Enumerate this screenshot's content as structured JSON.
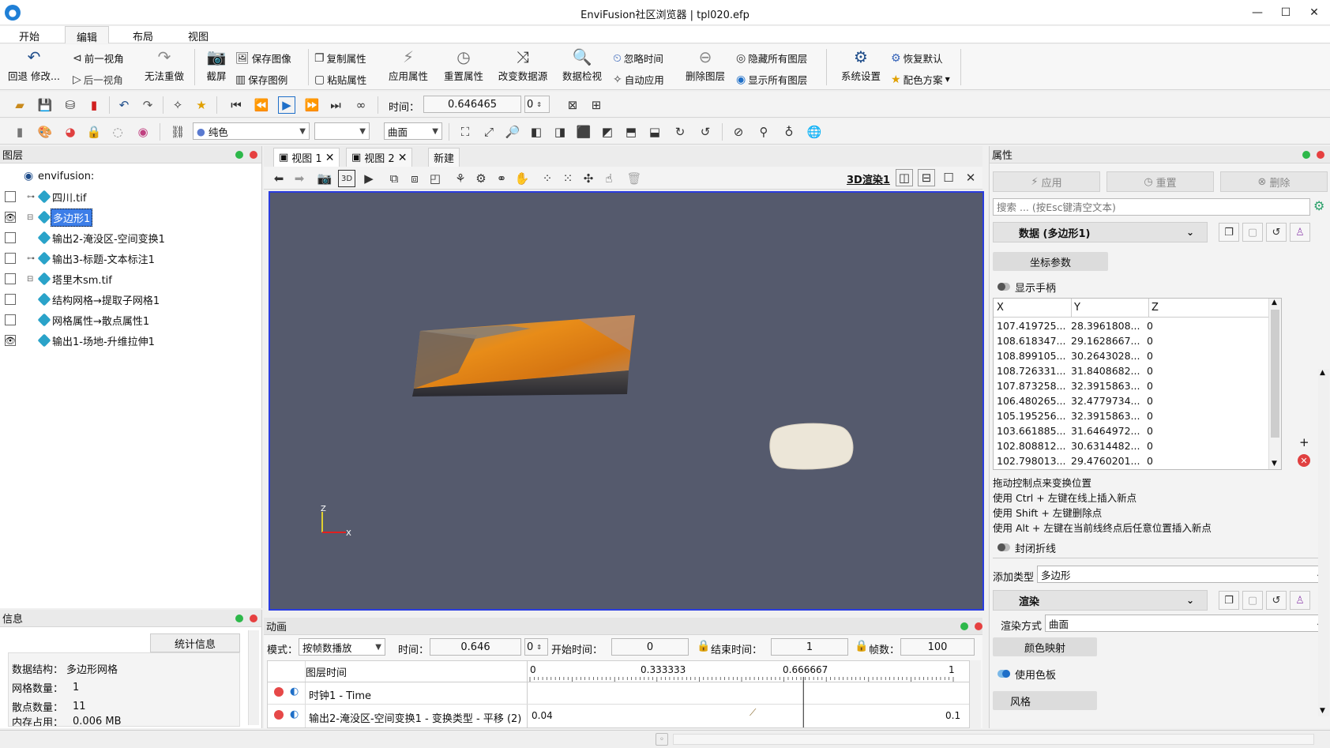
{
  "window": {
    "title": "EnviFusion社区浏览器 | tpl020.efp",
    "minimize": "—",
    "maximize": "☐",
    "close": "✕"
  },
  "menu": {
    "tabs": [
      "开始",
      "编辑",
      "布局",
      "视图"
    ],
    "active": "编辑"
  },
  "ribbon": {
    "undo": "回退 修改...",
    "prev_view": "前一视角",
    "next_view": "后一视角",
    "redo": "无法重做",
    "screenshot": "截屏",
    "save_image": "保存图像",
    "save_legend": "保存图例",
    "copy_props": "复制属性",
    "paste_props": "粘贴属性",
    "apply_props": "应用属性",
    "reset_props": "重置属性",
    "change_source": "改变数据源",
    "data_inspect": "数据检视",
    "ignore_time": "忽略时间",
    "auto_apply": "自动应用",
    "delete_layer": "删除图层",
    "hide_all": "隐藏所有图层",
    "show_all": "显示所有图层",
    "system_settings": "系统设置",
    "restore_default": "恢复默认",
    "color_scheme": "配色方案"
  },
  "toolbar2": {
    "time_label": "时间：",
    "time_value": "0.646465",
    "step_value": "0"
  },
  "toolbar3": {
    "color_mode": "纯色",
    "blank_combo": "",
    "surface_mode": "曲面"
  },
  "layers_panel": {
    "title": "图层",
    "root": "envifusion:",
    "items": [
      {
        "label": "四川.tif",
        "visible": false
      },
      {
        "label": "多边形1",
        "visible": true,
        "selected": true
      },
      {
        "label": "输出2-淹没区-空间变换1",
        "visible": false
      },
      {
        "label": "输出3-标题-文本标注1",
        "visible": false
      },
      {
        "label": "塔里木sm.tif",
        "visible": false
      },
      {
        "label": "结构网格→提取子网格1",
        "visible": false
      },
      {
        "label": "网格属性→散点属性1",
        "visible": false
      },
      {
        "label": "输出1-场地-升维拉伸1",
        "visible": true
      }
    ]
  },
  "info_panel": {
    "title": "信息",
    "tab": "统计信息",
    "rows": [
      {
        "label": "数据结构：",
        "value": "多边形网格"
      },
      {
        "label": "网格数量：",
        "value": "1"
      },
      {
        "label": "散点数量：",
        "value": "11"
      },
      {
        "label": "内存占用：",
        "value": "0.006 MB"
      }
    ]
  },
  "views": {
    "tabs": [
      "视图 1",
      "视图 2"
    ],
    "new_tab": "新建",
    "render_label": "3D渲染1",
    "axis": {
      "z": "Z",
      "x": "X"
    },
    "colors": {
      "background": "#555a6d",
      "border": "#2a3cdf",
      "terrain": "#e08a1e",
      "ellipse": "#ece6d8"
    }
  },
  "animation": {
    "title": "动画",
    "mode_label": "模式：",
    "mode_value": "按帧数播放",
    "time_label": "时间：",
    "time_value": "0.646",
    "step_value": "0",
    "start_label": "开始时间：",
    "start_value": "0",
    "end_label": "结束时间：",
    "end_value": "1",
    "frames_label": "帧数：",
    "frames_value": "100",
    "track_header": "图层时间",
    "ruler": [
      "0",
      "0.333333",
      "0.666667",
      "1"
    ],
    "tracks": [
      {
        "label": "时钟1 - Time",
        "start": "",
        "end": ""
      },
      {
        "label": "输出2-淹没区-空间变换1 - 变换类型 - 平移 (2)",
        "start": "0.04",
        "end": "0.1"
      }
    ],
    "current_time": 0.646
  },
  "properties": {
    "title": "属性",
    "apply": "应用",
    "reset": "重置",
    "delete": "删除",
    "search_placeholder": "搜索 ... (按Esc键清空文本)",
    "data_section": "数据 (多边形1)",
    "coord_params": "坐标参数",
    "show_handles": "显示手柄",
    "columns": [
      "X",
      "Y",
      "Z"
    ],
    "rows": [
      [
        "107.419725...",
        "28.3961808...",
        "0"
      ],
      [
        "108.618347...",
        "29.1628667...",
        "0"
      ],
      [
        "108.899105...",
        "30.2643028...",
        "0"
      ],
      [
        "108.726331...",
        "31.8408682...",
        "0"
      ],
      [
        "107.873258...",
        "32.3915863...",
        "0"
      ],
      [
        "106.480265...",
        "32.4779734...",
        "0"
      ],
      [
        "105.195256...",
        "32.3915863...",
        "0"
      ],
      [
        "103.661885...",
        "31.6464972...",
        "0"
      ],
      [
        "102.808812...",
        "30.6314482...",
        "0"
      ],
      [
        "102.798013...",
        "29.4760201...",
        "0"
      ]
    ],
    "help": [
      "拖动控制点来变换位置",
      "使用 Ctrl + 左键在线上插入新点",
      "使用 Shift + 左键删除点",
      "使用 Alt + 左键在当前线终点后任意位置插入新点"
    ],
    "close_polyline": "封闭折线",
    "add_type_label": "添加类型",
    "add_type_value": "多边形",
    "render_section": "渲染",
    "render_mode_label": "渲染方式",
    "render_mode_value": "曲面",
    "color_map": "颜色映射",
    "use_palette": "使用色板",
    "style": "风格"
  }
}
